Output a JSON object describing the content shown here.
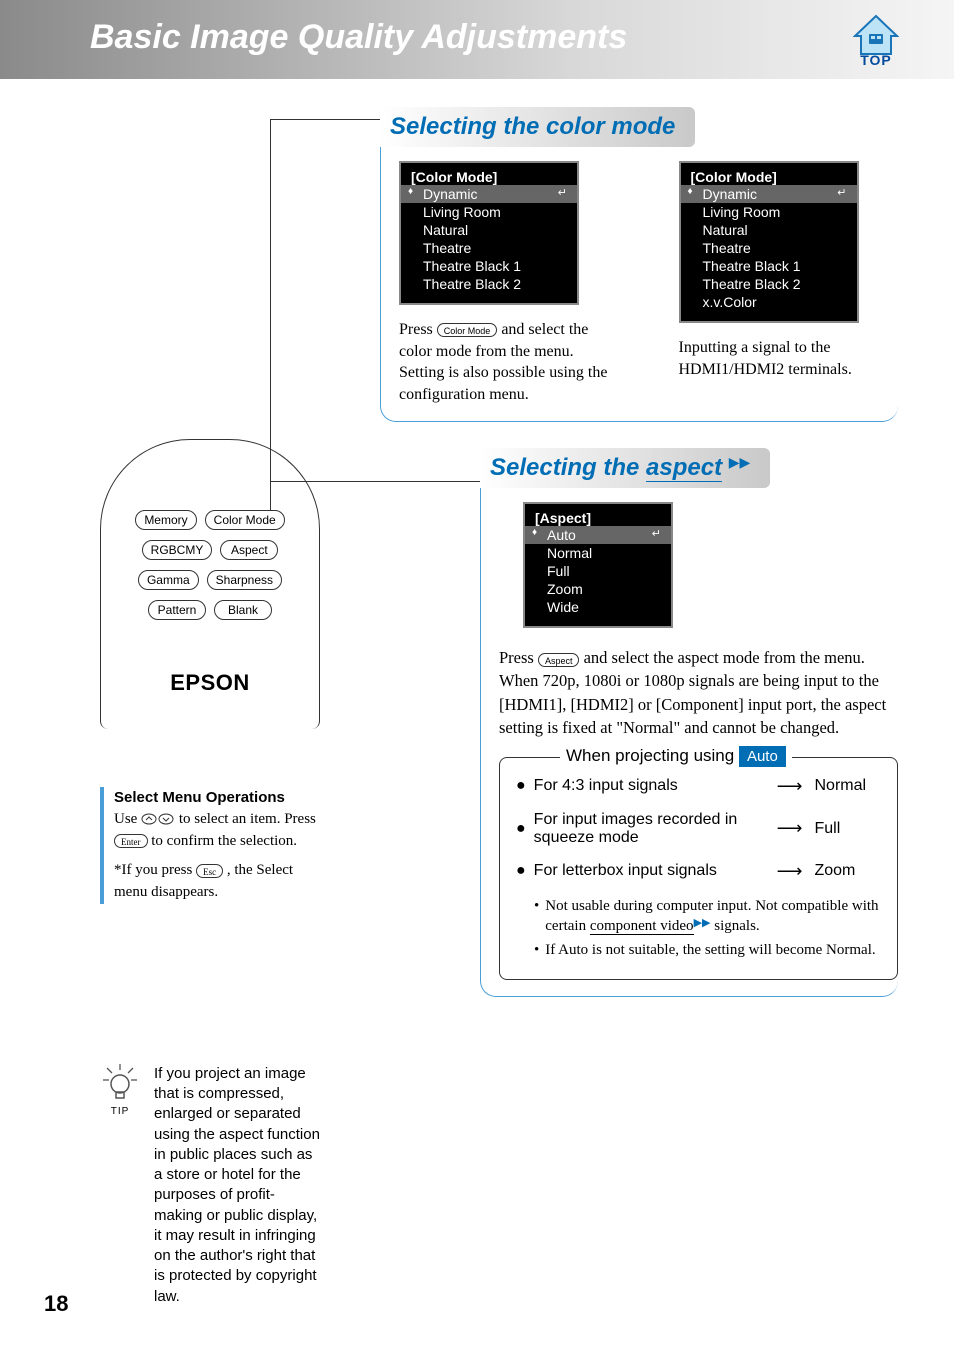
{
  "header": {
    "title": "Basic Image Quality Adjustments",
    "top_label": "TOP"
  },
  "remote": {
    "buttons": [
      [
        "Memory",
        "Color Mode"
      ],
      [
        "RGBCMY",
        "Aspect"
      ],
      [
        "Gamma",
        "Sharpness"
      ],
      [
        "Pattern",
        "Blank"
      ]
    ],
    "brand": "EPSON"
  },
  "select_ops": {
    "title": "Select Menu Operations",
    "line1_a": "Use ",
    "line1_b": " to select an item. Press ",
    "line2_a": " to confirm the selection.",
    "line3_a": "*If you press ",
    "esc": "Esc",
    "enter": "Enter",
    "line3_b": ", the Select menu disappears."
  },
  "tip": {
    "label": "TIP",
    "text": "If you project an image that is compressed, enlarged or separated using the aspect function in public places such as a store or hotel for the purposes of profit-making or public display, it may result in infringing on the author's right that is protected by copyright law."
  },
  "section_color": {
    "heading": "Selecting the color mode",
    "menu1": {
      "title": "[Color Mode]",
      "items": [
        "Dynamic",
        "Living Room",
        "Natural",
        "Theatre",
        "Theatre Black 1",
        "Theatre Black 2"
      ]
    },
    "menu2": {
      "title": "[Color Mode]",
      "items": [
        "Dynamic",
        "Living Room",
        "Natural",
        "Theatre",
        "Theatre Black 1",
        "Theatre Black 2",
        "x.v.Color"
      ]
    },
    "caption1_a": "Press ",
    "caption1_key": "Color Mode",
    "caption1_b": " and select the color mode from the menu. Setting is also possible using the configuration menu.",
    "caption2": "Inputting a signal to the HDMI1/HDMI2 terminals."
  },
  "section_aspect": {
    "heading_a": "Selecting the ",
    "heading_link": "aspect",
    "menu": {
      "title": "[Aspect]",
      "items": [
        "Auto",
        "Normal",
        "Full",
        "Zoom",
        "Wide"
      ]
    },
    "text_a": "Press ",
    "text_key": "Aspect",
    "text_b": " and select the aspect mode from the menu.",
    "text_c": "When 720p, 1080i or 1080p signals are being input to the [HDMI1], [HDMI2] or [Component] input port, the aspect setting is fixed at \"Normal\" and cannot be changed.",
    "auto_legend_a": "When projecting using ",
    "auto_pill": "Auto",
    "rows": [
      {
        "label": "For 4:3 input signals",
        "result": "Normal"
      },
      {
        "label": "For input images recorded in squeeze mode",
        "result": "Full"
      },
      {
        "label": "For letterbox input signals",
        "result": "Zoom"
      }
    ],
    "notes": [
      {
        "a": "Not usable during computer input. Not compatible with certain ",
        "link": "component video",
        "b": " signals."
      },
      {
        "a": "If Auto is not suitable, the setting will become Normal.",
        "link": "",
        "b": ""
      }
    ]
  },
  "page_number": "18"
}
